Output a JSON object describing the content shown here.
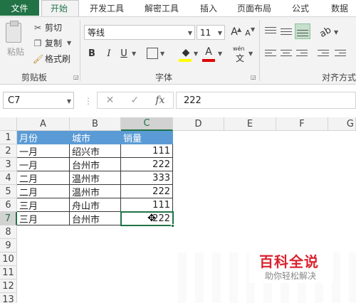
{
  "tabs": {
    "file": "文件",
    "items": [
      "开始",
      "开发工具",
      "解密工具",
      "插入",
      "页面布局",
      "公式",
      "数据"
    ]
  },
  "ribbon": {
    "clipboard": {
      "paste": "粘贴",
      "cut": "剪切",
      "copy": "复制",
      "format_painter": "格式刷",
      "group_label": "剪贴板"
    },
    "font": {
      "font_name": "等线",
      "font_size": "11",
      "grow": "A",
      "shrink": "A",
      "bold": "B",
      "italic": "I",
      "underline": "U",
      "font_color_letter": "A",
      "wen_top": "wén",
      "wen_char": "文",
      "group_label": "字体"
    },
    "alignment": {
      "group_label": "对齐方式"
    }
  },
  "formula_bar": {
    "name_box": "C7",
    "cancel": "✕",
    "enter": "✓",
    "fx": "fx",
    "content": "222"
  },
  "grid": {
    "columns": [
      "A",
      "B",
      "C",
      "D",
      "E",
      "F",
      "G"
    ],
    "rows": [
      "1",
      "2",
      "3",
      "4",
      "5",
      "6",
      "7",
      "8",
      "9",
      "10",
      "11",
      "12",
      "13"
    ],
    "header": [
      "月份",
      "城市",
      "销量"
    ],
    "data": [
      [
        "一月",
        "绍兴市",
        "111"
      ],
      [
        "一月",
        "台州市",
        "222"
      ],
      [
        "二月",
        "温州市",
        "333"
      ],
      [
        "二月",
        "温州市",
        "222"
      ],
      [
        "三月",
        "舟山市",
        "111"
      ],
      [
        "三月",
        "台州市",
        "222"
      ]
    ],
    "active_cell": "C7"
  },
  "watermark": {
    "title": "百科全说",
    "subtitle": "助你轻松解决"
  },
  "colors": {
    "excel_green": "#217346",
    "header_fill": "#5b9bd5",
    "watermark_red": "#d9232f"
  }
}
